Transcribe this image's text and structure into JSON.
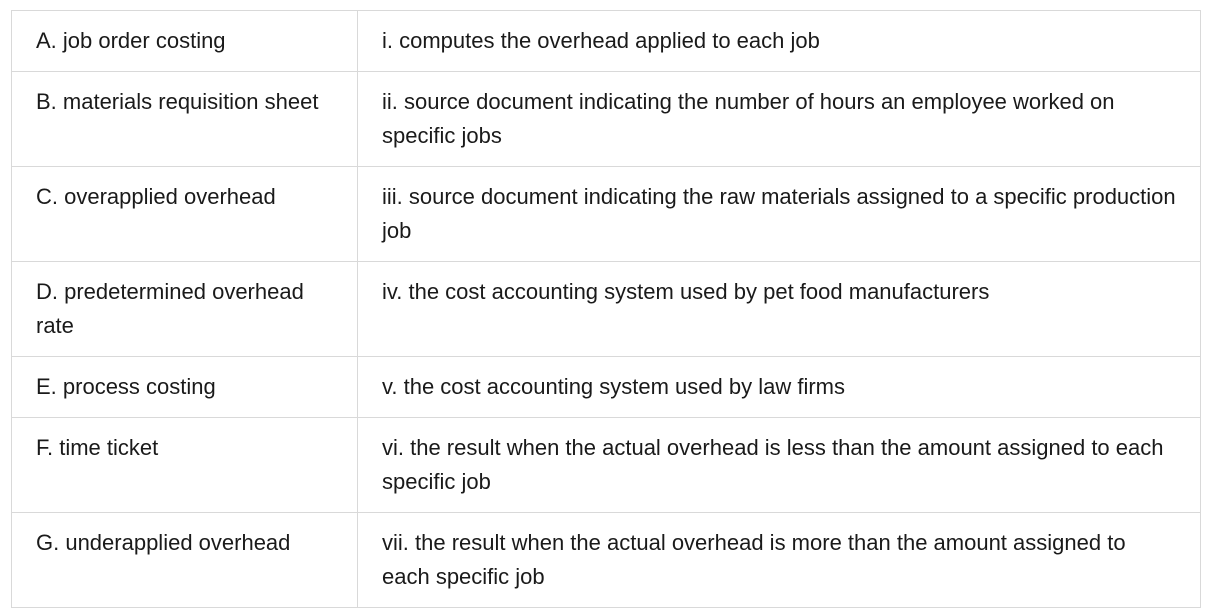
{
  "rows": [
    {
      "term": "A. job order costing",
      "definition": "i. computes the overhead applied to each job"
    },
    {
      "term": "B. materials requisition sheet",
      "definition": "ii. source document indicating the number of hours an employee worked on specific jobs"
    },
    {
      "term": "C. overapplied overhead",
      "definition": "iii. source document indicating the raw materials assigned to a specific production job"
    },
    {
      "term": "D. predetermined overhead rate",
      "definition": "iv. the cost accounting system used by pet food manufacturers"
    },
    {
      "term": "E. process costing",
      "definition": "v. the cost accounting system used by law firms"
    },
    {
      "term": "F. time ticket",
      "definition": "vi. the result when the actual overhead is less than the amount assigned to each specific job"
    },
    {
      "term": "G. underapplied overhead",
      "definition": "vii. the result when the actual overhead is more than the amount assigned to each specific job"
    }
  ]
}
